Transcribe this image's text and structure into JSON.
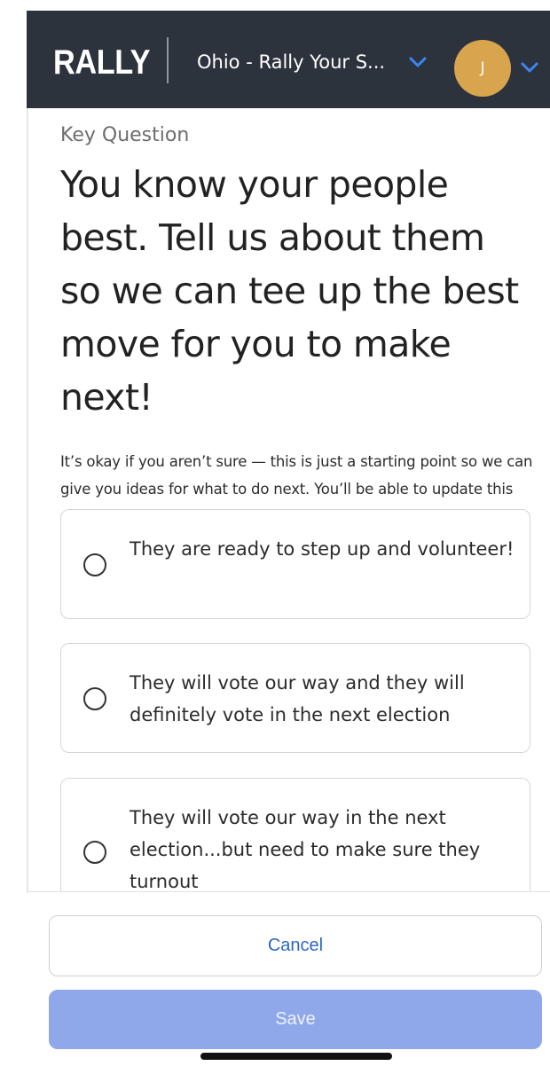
{
  "header": {
    "brand": "RALLY",
    "campaign_name": "Ohio - Rally Your S...",
    "avatar_initial": "J"
  },
  "content": {
    "eyebrow": "Key Question",
    "headline": "You know your people best. Tell us about them so we can tee up the best move for you to make next!",
    "help_text": "It’s okay if you aren’t sure — this is just a starting point so we can give you ideas for what to do next. You’ll be able to update this answer later.",
    "options": [
      {
        "label": "They are ready to step up and volunteer!"
      },
      {
        "label": "They will vote our way and they will definitely vote in the next election"
      },
      {
        "label": "They will vote our way in the next election...but need to make sure they turnout"
      }
    ]
  },
  "actions": {
    "cancel_label": "Cancel",
    "save_label": "Save"
  },
  "icons": {
    "chevron": "chevron-down-icon",
    "radio": "radio-unselected-icon"
  },
  "colors": {
    "header_bg": "#2d333d",
    "chevron": "#3c86f5",
    "avatar_bg": "#d8a44d",
    "cancel_text": "#2d66c4",
    "save_bg_disabled": "#8fa8ea"
  }
}
